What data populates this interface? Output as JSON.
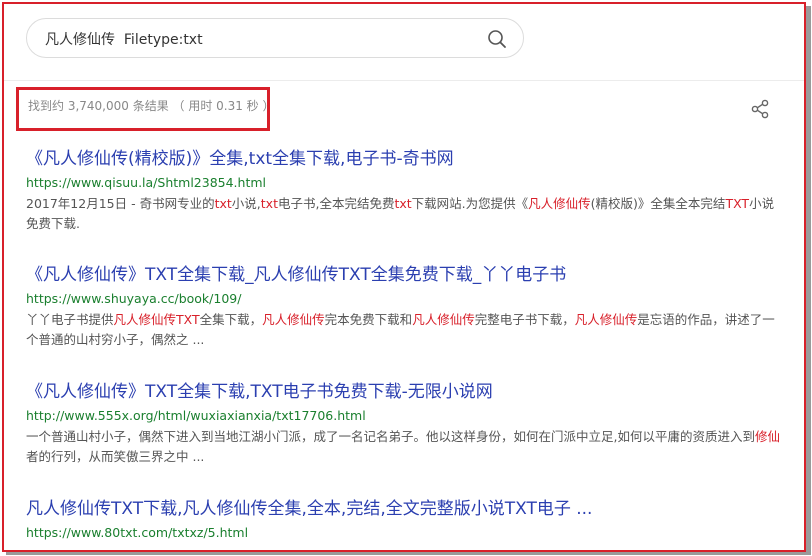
{
  "search": {
    "query": "凡人修仙传  Filetype:txt",
    "icon": "search-icon"
  },
  "stats": "找到约 3,740,000 条结果 （ 用时 0.31 秒 ）",
  "share_icon": "share-icon",
  "results": [
    {
      "title": "《凡人修仙传(精校版)》全集,txt全集下载,电子书-奇书网",
      "url": "https://www.qisuu.la/Shtml23854.html",
      "desc": [
        {
          "t": "2017年12月15日 - 奇书网专业的"
        },
        {
          "t": "txt",
          "h": true
        },
        {
          "t": "小说,"
        },
        {
          "t": "txt",
          "h": true
        },
        {
          "t": "电子书,全本完结免费"
        },
        {
          "t": "txt",
          "h": true
        },
        {
          "t": "下载网站.为您提供《"
        },
        {
          "t": "凡人修仙传",
          "h": true
        },
        {
          "t": "(精校版)》全集全本完结"
        },
        {
          "t": "TXT",
          "h": true
        },
        {
          "t": "小说免费下载."
        }
      ]
    },
    {
      "title": "《凡人修仙传》TXT全集下载_凡人修仙传TXT全集免费下载_丫丫电子书",
      "url": "https://www.shuyaya.cc/book/109/",
      "desc": [
        {
          "t": "丫丫电子书提供"
        },
        {
          "t": "凡人修仙传TXT",
          "h": true
        },
        {
          "t": "全集下载，"
        },
        {
          "t": "凡人修仙传",
          "h": true
        },
        {
          "t": "完本免费下载和"
        },
        {
          "t": "凡人修仙传",
          "h": true
        },
        {
          "t": "完整电子书下载，"
        },
        {
          "t": "凡人修仙传",
          "h": true
        },
        {
          "t": "是忘语的作品，讲述了一个普通的山村穷小子，偶然之 ..."
        }
      ]
    },
    {
      "title": "《凡人修仙传》TXT全集下载,TXT电子书免费下载-无限小说网",
      "url": "http://www.555x.org/html/wuxiaxianxia/txt17706.html",
      "desc": [
        {
          "t": "一个普通山村小子，偶然下进入到当地江湖小门派，成了一名记名弟子。他以这样身份，如何在门派中立足,如何以平庸的资质进入到"
        },
        {
          "t": "修仙",
          "h": true
        },
        {
          "t": "者的行列，从而笑傲三界之中 ..."
        }
      ]
    },
    {
      "title": "凡人修仙传TXT下载,凡人修仙传全集,全本,完结,全文完整版小说TXT电子 ...",
      "url": "https://www.80txt.com/txtxz/5.html",
      "desc": []
    }
  ],
  "colors": {
    "title": "#2b3fb0",
    "url": "#1a7f2e",
    "highlight": "#d8202a",
    "frame": "#d8202a"
  }
}
